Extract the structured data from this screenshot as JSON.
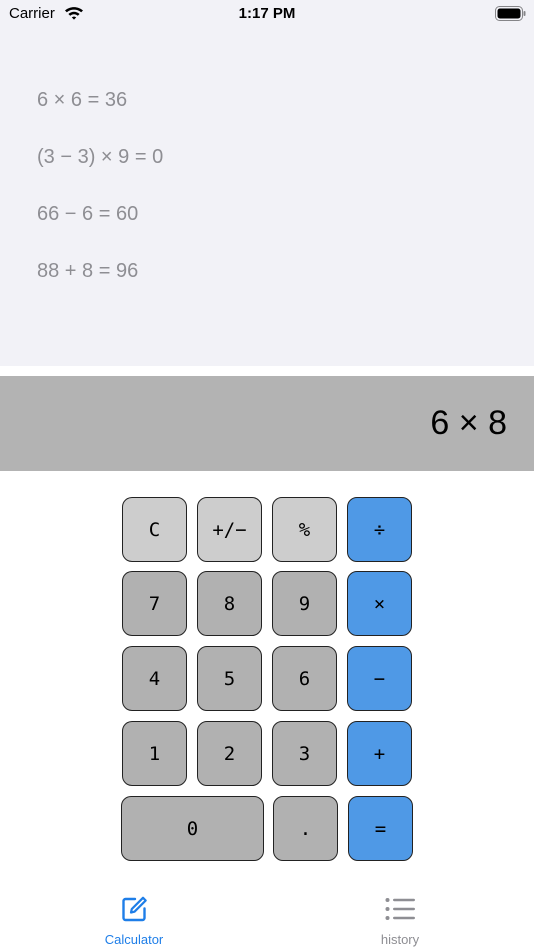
{
  "status_bar": {
    "carrier": "Carrier",
    "time": "1:17 PM"
  },
  "history": {
    "items": [
      "6 × 6 = 36",
      "(3 − 3) × 9 = 0",
      "66 − 6 = 60",
      "88 + 8 = 96"
    ]
  },
  "display": {
    "value": "6 × 8"
  },
  "keypad": {
    "clear": "C",
    "sign": "+/−",
    "percent": "%",
    "divide": "÷",
    "seven": "7",
    "eight": "8",
    "nine": "9",
    "multiply": "×",
    "four": "4",
    "five": "5",
    "six": "6",
    "subtract": "−",
    "one": "1",
    "two": "2",
    "three": "3",
    "add": "+",
    "zero": "0",
    "decimal": ".",
    "equals": "="
  },
  "tabbar": {
    "calculator_label": "Calculator",
    "history_label": "history"
  },
  "colors": {
    "accent": "#1e7ee8",
    "operator_key": "#4f99e6",
    "inactive_tab": "#8e8e93"
  }
}
